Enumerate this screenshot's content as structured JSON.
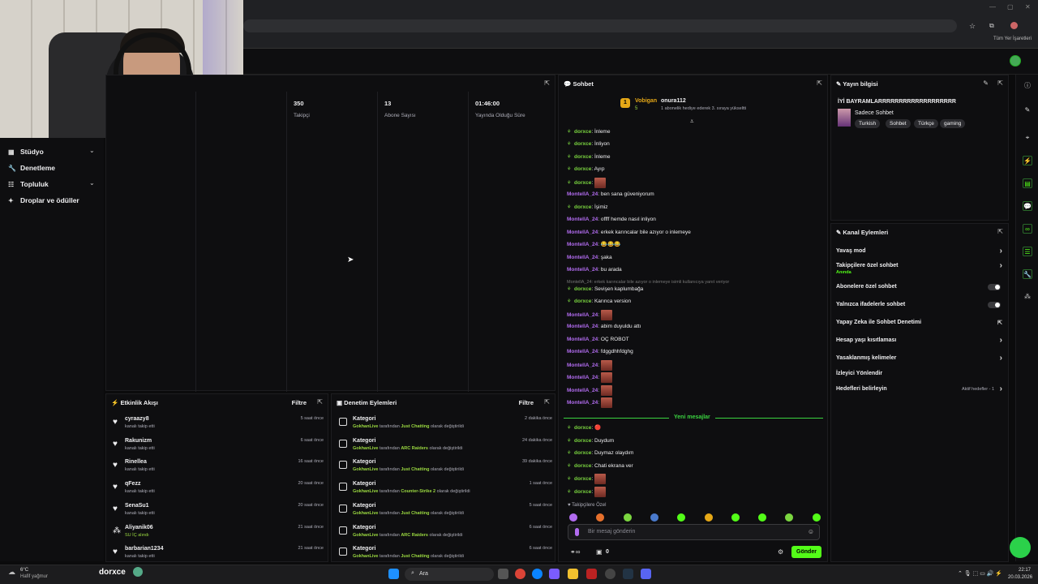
{
  "browser": {
    "bookmarks_label": "Tüm Yer İşaretleri"
  },
  "sidebar": {
    "items": [
      {
        "label": "Stüdyo",
        "icon": "studio-icon",
        "chevron": true
      },
      {
        "label": "Denetleme",
        "icon": "wrench-icon",
        "chevron": false
      },
      {
        "label": "Topluluk",
        "icon": "community-icon",
        "chevron": true
      },
      {
        "label": "Droplar ve ödüller",
        "icon": "gift-icon",
        "chevron": false
      }
    ]
  },
  "stats": [
    {
      "value": "350",
      "label": "Takipçi"
    },
    {
      "value": "13",
      "label": "Abone Sayısı"
    },
    {
      "value": "01:46:00",
      "label": "Yayında Olduğu Süre"
    }
  ],
  "feed": {
    "title": "Etkinlik Akışı",
    "filter": "Filtre",
    "rows": [
      {
        "name": "cyraazy8",
        "action": "kanalı takip etti",
        "time": "5 saat önce",
        "icon": "heart-icon"
      },
      {
        "name": "Rakunizm",
        "action": "kanalı takip etti",
        "time": "6 saat önce",
        "icon": "heart-icon"
      },
      {
        "name": "Rinellea",
        "action": "kanalı takip etti",
        "time": "16 saat önce",
        "icon": "heart-icon"
      },
      {
        "name": "qFezz",
        "action": "kanalı takip etti",
        "time": "20 saat önce",
        "icon": "heart-icon"
      },
      {
        "name": "SenaSu1",
        "action": "kanalı takip etti",
        "time": "20 saat önce",
        "icon": "heart-icon"
      },
      {
        "name": "Aliyanik06",
        "action": "SU İÇ alındı",
        "time": "21 saat önce",
        "icon": "reward-icon"
      },
      {
        "name": "barbarian1234",
        "action": "kanalı takip etti",
        "time": "21 saat önce",
        "icon": "heart-icon"
      }
    ]
  },
  "mod": {
    "title": "Denetim Eylemleri",
    "filter": "Filtre",
    "rows": [
      {
        "title": "Kategori",
        "by": "GokhanLive",
        "mid": "tarafından",
        "cat": "Just Chatting",
        "end": "olarak değiştirildi",
        "time": "2 dakika önce"
      },
      {
        "title": "Kategori",
        "by": "GokhanLive",
        "mid": "tarafından",
        "cat": "ARC Raiders",
        "end": "olarak değiştirildi",
        "time": "24 dakika önce"
      },
      {
        "title": "Kategori",
        "by": "GokhanLive",
        "mid": "tarafından",
        "cat": "Just Chatting",
        "end": "olarak değiştirildi",
        "time": "39 dakika önce"
      },
      {
        "title": "Kategori",
        "by": "GokhanLive",
        "mid": "tarafından",
        "cat": "Counter-Strike 2",
        "end": "olarak değiştirildi",
        "time": "1 saat önce"
      },
      {
        "title": "Kategori",
        "by": "GokhanLive",
        "mid": "tarafından",
        "cat": "Just Chatting",
        "end": "olarak değiştirildi",
        "time": "5 saat önce"
      },
      {
        "title": "Kategori",
        "by": "GokhanLive",
        "mid": "tarafından",
        "cat": "ARC Raiders",
        "end": "olarak değiştirildi",
        "time": "6 saat önce"
      },
      {
        "title": "Kategori",
        "by": "GokhanLive",
        "mid": "tarafından",
        "cat": "Just Chatting",
        "end": "olarak değiştirildi",
        "time": "6 saat önce"
      }
    ]
  },
  "chat": {
    "title": "Sohbet",
    "pinned": {
      "name1": "Vobigan",
      "name2": "onura112",
      "count": "5",
      "text": "1 abonelik hediye ederek 3. sıraya yükseltti"
    },
    "new_label": "Yeni mesajlar",
    "reply_note": "MontellA_24: erkek karıncalar bile azıyor o inlemeye isimli kullanıcıya yanıt veriyor",
    "messages": [
      {
        "user": "dorxce",
        "text": "İnleme",
        "color": "#7bd640",
        "badge": true
      },
      {
        "user": "dorxce",
        "text": "İnliyon",
        "color": "#7bd640",
        "badge": true
      },
      {
        "user": "dorxce",
        "text": "İnleme",
        "color": "#7bd640",
        "badge": true
      },
      {
        "user": "dorxce",
        "text": "Ayıp",
        "color": "#7bd640",
        "badge": true
      },
      {
        "user": "dorxce",
        "text": "",
        "emote": true,
        "color": "#7bd640",
        "badge": true
      },
      {
        "user": "MontellA_24",
        "text": "ben sana güveniyorum",
        "color": "#b26cf0"
      },
      {
        "user": "dorxce",
        "text": "İşimiz",
        "color": "#7bd640",
        "badge": true
      },
      {
        "user": "MontellA_24",
        "text": "offff hemde nasıl inliyon",
        "color": "#b26cf0"
      },
      {
        "user": "MontellA_24",
        "text": "erkek karıncalar bile azıyor o inlemeye",
        "color": "#b26cf0"
      },
      {
        "user": "MontellA_24",
        "text": "😂😂😂",
        "color": "#b26cf0"
      },
      {
        "user": "MontellA_24",
        "text": "şaka",
        "color": "#b26cf0"
      },
      {
        "user": "MontellA_24",
        "text": "bu arada",
        "color": "#b26cf0"
      },
      {
        "user": "dorxce",
        "text": "Sevişen kaplumbağa",
        "color": "#7bd640",
        "badge": true
      },
      {
        "user": "dorxce",
        "text": "Karınca version",
        "color": "#7bd640",
        "badge": true
      },
      {
        "user": "MontellA_24",
        "text": "",
        "emote": true,
        "color": "#b26cf0"
      },
      {
        "user": "MontellA_24",
        "text": "abim duyuldu attı",
        "color": "#b26cf0"
      },
      {
        "user": "MontellA_24",
        "text": "OÇ ROBOT",
        "color": "#b26cf0"
      },
      {
        "user": "MontellA_24",
        "text": "fdggdhhfdghg",
        "color": "#b26cf0"
      },
      {
        "user": "MontellA_24",
        "text": "",
        "emote": true,
        "color": "#b26cf0"
      },
      {
        "user": "MontellA_24",
        "text": "",
        "emote": true,
        "color": "#b26cf0"
      },
      {
        "user": "MontellA_24",
        "text": "",
        "emote": true,
        "color": "#b26cf0"
      },
      {
        "user": "MontellA_24",
        "text": "",
        "emote": true,
        "color": "#b26cf0"
      }
    ],
    "after": [
      {
        "user": "dorxce",
        "text": "🔴",
        "color": "#7bd640",
        "badge": true
      },
      {
        "user": "dorxce",
        "text": "Duydum",
        "color": "#7bd640",
        "badge": true
      },
      {
        "user": "dorxce",
        "text": "Duymaz olaydım",
        "color": "#7bd640",
        "badge": true
      },
      {
        "user": "dorxce",
        "text": "Chati ekrana ver",
        "color": "#7bd640",
        "badge": true
      },
      {
        "user": "dorxce",
        "text": "",
        "emote": true,
        "color": "#7bd640",
        "badge": true
      },
      {
        "user": "dorxce",
        "text": "",
        "emote": true,
        "color": "#7bd640",
        "badge": true
      }
    ],
    "followers_only": "Takipçilere Özel",
    "placeholder": "Bir mesaj gönderin",
    "send": "Gönder",
    "counter": "0"
  },
  "info": {
    "title": "Yayın bilgisi",
    "stream_title": "İYİ BAYRAMLARRRRRRRRRRRRRRRRRRR",
    "category": "Sadece Sohbet",
    "tags": [
      "Turkish",
      "Sohbet",
      "Türkçe",
      "gaming"
    ]
  },
  "actions": {
    "title": "Kanal Eylemleri",
    "rows": [
      {
        "label": "Yavaş mod",
        "control": "chevron"
      },
      {
        "label": "Takipçilere özel sohbet",
        "sub": "Anında",
        "control": "chevron"
      },
      {
        "label": "Abonelere özel sohbet",
        "control": "toggle"
      },
      {
        "label": "Yalnızca ifadelerle sohbet",
        "control": "toggle"
      },
      {
        "label": "Yapay Zeka ile Sohbet Denetimi",
        "control": "external"
      },
      {
        "label": "Hesap yaşı kısıtlaması",
        "control": "chevron"
      },
      {
        "label": "Yasaklanmış kelimeler",
        "control": "chevron"
      },
      {
        "label": "İzleyici Yönlendir",
        "control": "none"
      },
      {
        "label": "Hedefleri belirleyin",
        "control": "chevron",
        "extra": "Aktif hedefler - 1"
      }
    ]
  },
  "taskbar": {
    "weather_temp": "6°C",
    "weather_text": "Hafif yağmur",
    "channel": "dorxce",
    "search": "Ara",
    "time": "22:17",
    "date": "20.03.2026"
  },
  "colors": {
    "accent": "#53fc18",
    "bg": "#0e0e10",
    "chat_user_green": "#7bd640",
    "chat_user_purple": "#b26cf0"
  }
}
